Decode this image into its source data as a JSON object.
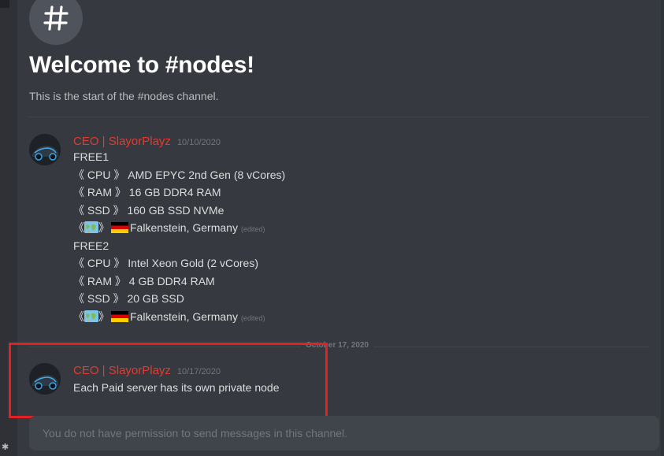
{
  "channel": {
    "welcome_title": "Welcome to #nodes!",
    "welcome_subtitle": "This is the start of the #nodes channel.",
    "icon": "hash-icon"
  },
  "date_separator": "October 17, 2020",
  "messages": [
    {
      "author": "CEO | SlayorPlayz",
      "author_color": "#e03c31",
      "timestamp": "10/10/2020",
      "lines": [
        {
          "text": "FREE1"
        },
        {
          "bracket_l": "《",
          "tag": " CPU ",
          "bracket_r": "》",
          "value": "AMD EPYC 2nd Gen (8 vCores)"
        },
        {
          "bracket_l": "《",
          "tag": " RAM ",
          "bracket_r": "》",
          "value": "16 GB DDR4 RAM"
        },
        {
          "bracket_l": "《",
          "tag": " SSD ",
          "bracket_r": "》",
          "value": "160 GB SSD NVMe"
        },
        {
          "bracket_l": "《",
          "icon": "world-map-emoji",
          "bracket_r": "》",
          "flag": "flag-germany",
          "value": "Falkenstein, Germany",
          "edited": "(edited)"
        },
        {
          "text": "FREE2"
        },
        {
          "bracket_l": "《",
          "tag": " CPU ",
          "bracket_r": "》",
          "value": "Intel Xeon Gold (2 vCores)"
        },
        {
          "bracket_l": "《",
          "tag": " RAM ",
          "bracket_r": "》",
          "value": "4 GB DDR4 RAM"
        },
        {
          "bracket_l": "《",
          "tag": " SSD ",
          "bracket_r": "》",
          "value": "20 GB SSD"
        },
        {
          "bracket_l": "《",
          "icon": "world-map-emoji",
          "bracket_r": "》",
          "flag": "flag-germany",
          "value": "Falkenstein, Germany",
          "edited": "(edited)"
        }
      ]
    },
    {
      "author": "CEO | SlayorPlayz",
      "author_color": "#e03c31",
      "timestamp": "10/17/2020",
      "lines": [
        {
          "text": "Each Paid server has its own private node"
        }
      ]
    }
  ],
  "composer": {
    "placeholder": "You do not have permission to send messages in this channel."
  },
  "colors": {
    "background": "#36393f",
    "highlight_border": "#e02222"
  }
}
